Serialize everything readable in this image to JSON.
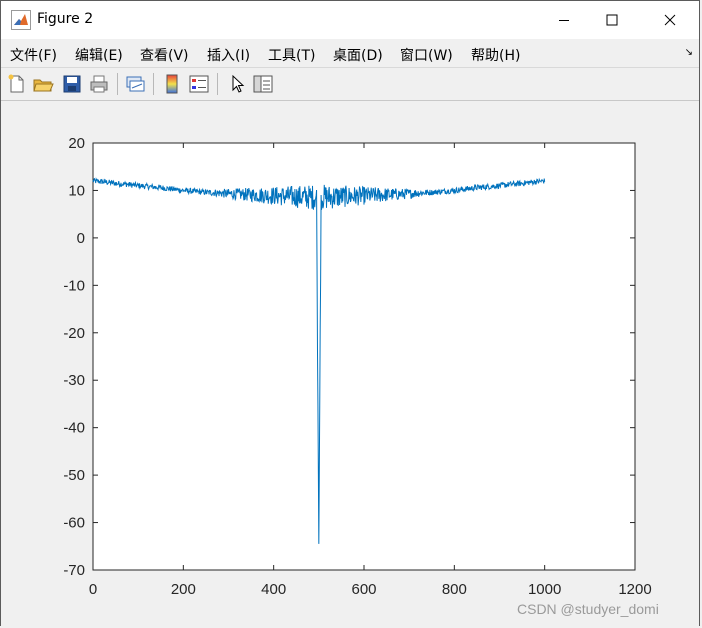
{
  "window": {
    "title": "Figure 2"
  },
  "menu": {
    "items": [
      {
        "label": "文件(F)"
      },
      {
        "label": "编辑(E)"
      },
      {
        "label": "查看(V)"
      },
      {
        "label": "插入(I)"
      },
      {
        "label": "工具(T)"
      },
      {
        "label": "桌面(D)"
      },
      {
        "label": "窗口(W)"
      },
      {
        "label": "帮助(H)"
      }
    ]
  },
  "toolbar": {
    "buttons": [
      "new-figure-icon",
      "open-file-icon",
      "save-icon",
      "print-icon",
      "link-plot-icon",
      "colorbar-icon",
      "legend-icon",
      "pointer-icon",
      "property-inspector-icon"
    ]
  },
  "colors": {
    "series": "#0072bd",
    "axes_bg": "#ffffff",
    "figure_bg": "#f0f0f0"
  },
  "chart_data": {
    "type": "line",
    "title": "",
    "xlabel": "",
    "ylabel": "",
    "xlim": [
      0,
      1200
    ],
    "ylim": [
      -70,
      20
    ],
    "xticks": [
      0,
      200,
      400,
      600,
      800,
      1000,
      1200
    ],
    "yticks": [
      20,
      10,
      0,
      -10,
      -20,
      -30,
      -40,
      -50,
      -60,
      -70
    ],
    "grid": false,
    "series": [
      {
        "points": [
          [
            0,
            12
          ],
          [
            25,
            11.8
          ],
          [
            50,
            11.5
          ],
          [
            75,
            11.3
          ],
          [
            100,
            11.0
          ],
          [
            125,
            10.8
          ],
          [
            150,
            10.6
          ],
          [
            175,
            10.3
          ],
          [
            200,
            10.0
          ],
          [
            225,
            9.8
          ],
          [
            250,
            9.6
          ],
          [
            275,
            9.5
          ],
          [
            300,
            9.3
          ],
          [
            325,
            9.2
          ],
          [
            350,
            9.1
          ],
          [
            375,
            9.0
          ],
          [
            400,
            8.9
          ],
          [
            425,
            8.8
          ],
          [
            450,
            8.7
          ],
          [
            475,
            8.6
          ],
          [
            490,
            8.6
          ],
          [
            495,
            8.5
          ],
          [
            500,
            -64.5
          ],
          [
            505,
            8.5
          ],
          [
            510,
            8.6
          ],
          [
            525,
            8.6
          ],
          [
            550,
            8.7
          ],
          [
            575,
            8.8
          ],
          [
            600,
            8.9
          ],
          [
            625,
            9.0
          ],
          [
            650,
            9.1
          ],
          [
            675,
            9.2
          ],
          [
            700,
            9.3
          ],
          [
            725,
            9.5
          ],
          [
            750,
            9.6
          ],
          [
            775,
            9.8
          ],
          [
            800,
            10.0
          ],
          [
            825,
            10.3
          ],
          [
            850,
            10.6
          ],
          [
            875,
            10.8
          ],
          [
            900,
            11.0
          ],
          [
            925,
            11.3
          ],
          [
            950,
            11.5
          ],
          [
            975,
            11.8
          ],
          [
            1000,
            12
          ]
        ]
      }
    ]
  },
  "watermark": {
    "text": "CSDN @studyer_domi"
  }
}
